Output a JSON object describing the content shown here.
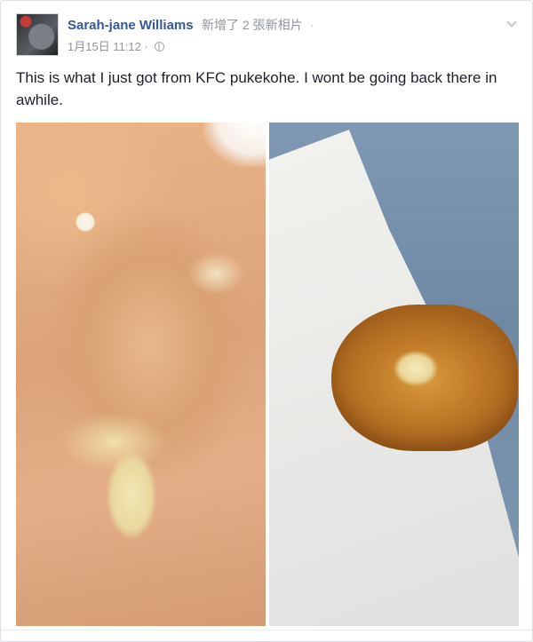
{
  "post": {
    "author": "Sarah-jane Williams",
    "action": "新增了 2 張新相片",
    "separator": "·",
    "timestamp": "1月15日 11:12",
    "timestamp_separator": "·",
    "privacy_icon": "globe-icon",
    "options_icon": "chevron-down-icon",
    "text": "This is what I just got from KFC pukekohe. I wont be going back there in awhile."
  },
  "photos": [
    {
      "icon": "photo",
      "description_visible": false
    },
    {
      "icon": "photo",
      "description_visible": false
    }
  ],
  "colors": {
    "author": "#365899",
    "meta": "#90949c",
    "text": "#1d2129",
    "border": "#dddfe2"
  }
}
